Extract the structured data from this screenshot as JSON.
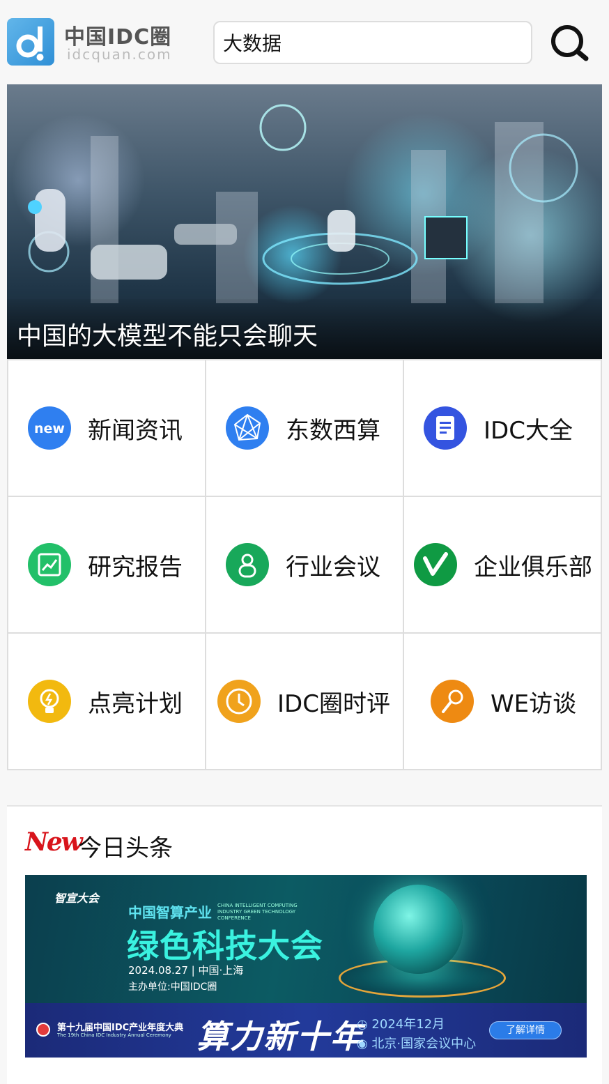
{
  "header": {
    "logo_title": "中国IDC圈",
    "logo_sub": "idcquan.com",
    "search_value": "大数据"
  },
  "hero": {
    "caption": "中国的大模型不能只会聊天"
  },
  "grid": {
    "items": [
      {
        "label": "新闻资讯",
        "icon": "new-badge-icon",
        "color": "#2f7ff0"
      },
      {
        "label": "东数西算",
        "icon": "network-icon",
        "color": "#2f7ff0"
      },
      {
        "label": "IDC大全",
        "icon": "document-icon",
        "color": "#3454e0"
      },
      {
        "label": "研究报告",
        "icon": "chart-trend-icon",
        "color": "#22c069"
      },
      {
        "label": "行业会议",
        "icon": "person-icon",
        "color": "#18a85a"
      },
      {
        "label": "企业俱乐部",
        "icon": "v-logo-icon",
        "color": "#0f9a43"
      },
      {
        "label": "点亮计划",
        "icon": "lightbulb-icon",
        "color": "#f2b90f"
      },
      {
        "label": "IDC圈时评",
        "icon": "clock-icon",
        "color": "#f0a21c"
      },
      {
        "label": "WE访谈",
        "icon": "microphone-icon",
        "color": "#ee8a12"
      }
    ]
  },
  "news": {
    "new_tag": "New",
    "title": "今日头条",
    "banner": {
      "brand": "智宣大会",
      "subtitle": "中国智算产业",
      "subtitle_en": "CHINA INTELLIGENT COMPUTING INDUSTRY GREEN TECHNOLOGY CONFERENCE",
      "main": "绿色科技大会",
      "date": "2024.08.27 | 中国·上海",
      "organizer": "主办单位:中国IDC圈",
      "strip_title": "第十九届中国IDC产业年度大典",
      "strip_title_en": "The 19th China IDC Industry Annual Ceremony",
      "strip_big": "算力新十年",
      "strip_date": "◷ 2024年12月",
      "strip_location": "◉ 北京·国家会议中心",
      "strip_button": "了解详情"
    }
  }
}
